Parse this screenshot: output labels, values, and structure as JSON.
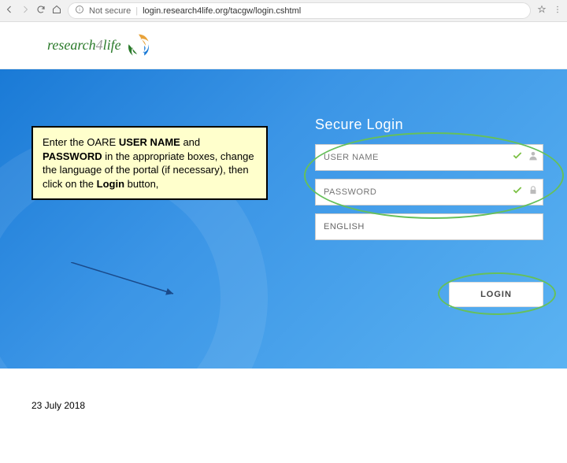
{
  "browser": {
    "url": "login.research4life.org/tacgw/login.cshtml",
    "security_label": "Not secure"
  },
  "logo": {
    "part1": "research",
    "part2": "4",
    "part3": "life"
  },
  "callout": {
    "pre": "Enter the OARE ",
    "b1": "USER NAME",
    "mid1": " and ",
    "b2": "PASSWORD",
    "mid2": " in the appropriate boxes, change the language of the portal (if necessary), then click on the ",
    "b3": "Login",
    "post": " button,"
  },
  "login": {
    "title": "Secure Login",
    "username_placeholder": "USER NAME",
    "password_placeholder": "PASSWORD",
    "language": "ENGLISH",
    "button": "LOGIN"
  },
  "footer": {
    "date": "23 July 2018"
  }
}
